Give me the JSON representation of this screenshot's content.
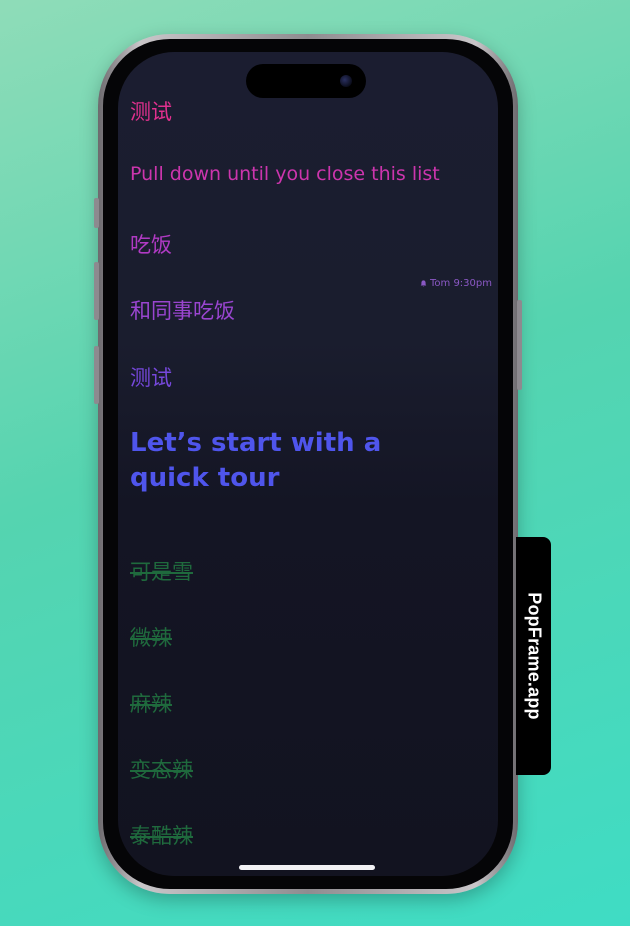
{
  "list": {
    "items": [
      {
        "text": "测试",
        "color": "#e2308f"
      },
      {
        "text": "Pull down until you close this list",
        "color": "#cc35ad"
      },
      {
        "text": "吃饭",
        "color": "#b03ac4"
      },
      {
        "text": "和同事吃饭",
        "color": "#9a45d0"
      },
      {
        "text": "测试",
        "color": "#7648dc"
      }
    ],
    "reminder": "Tom 9:30pm",
    "heading": "Let’s start with a quick tour",
    "completed": [
      "可是雪",
      "微辣",
      "麻辣",
      "变态辣",
      "泰酷辣"
    ]
  },
  "badge": {
    "label": "PopFrame.app"
  },
  "colors": {
    "heading": "#4f55ec",
    "completed": "#1f6a3d"
  }
}
